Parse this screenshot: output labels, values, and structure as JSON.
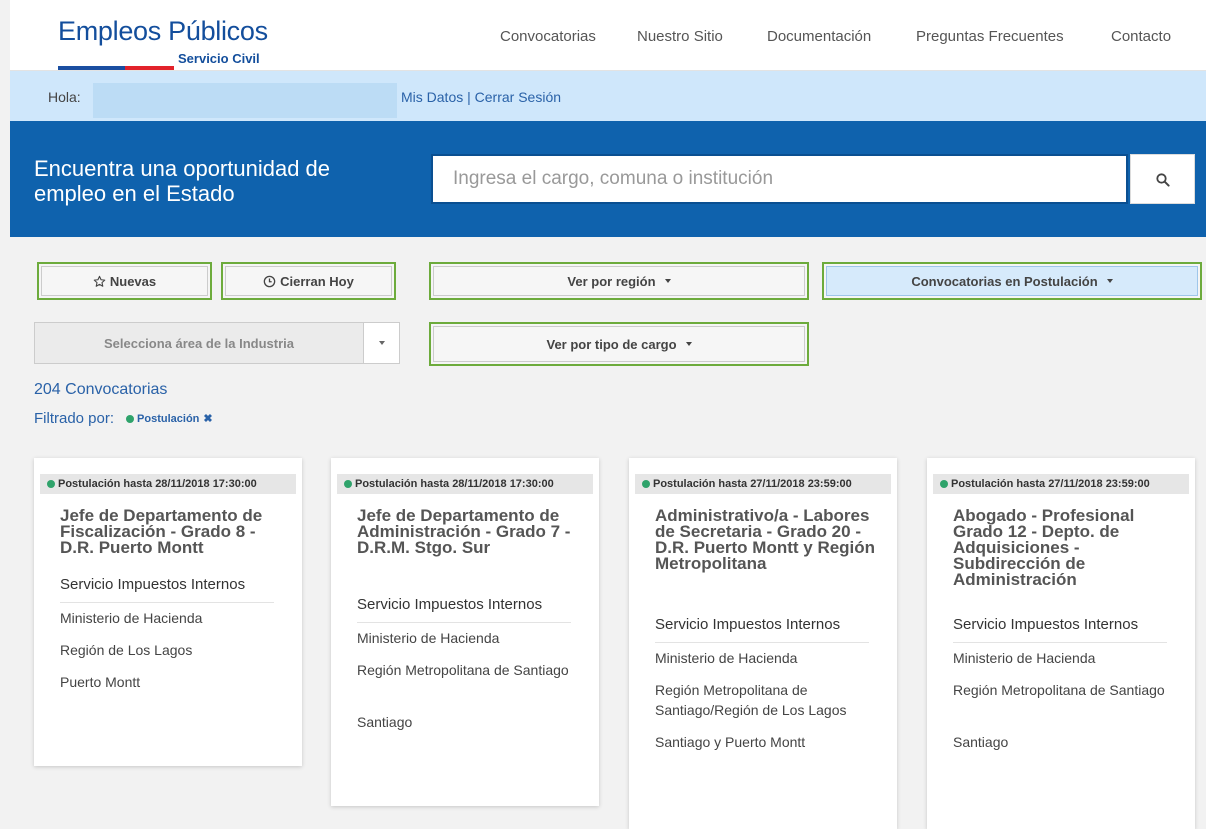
{
  "header": {
    "logo_title": "Empleos Públicos",
    "logo_subtitle": "Servicio Civil",
    "nav": [
      "Convocatorias",
      "Nuestro Sitio",
      "Documentación",
      "Preguntas Frecuentes",
      "Contacto"
    ]
  },
  "userbar": {
    "greeting": "Hola:",
    "my_data": "Mis Datos",
    "separator": "|",
    "logout": "Cerrar Sesión"
  },
  "hero": {
    "text": "Encuentra una oportunidad de empleo en el Estado",
    "search_placeholder": "Ingresa el cargo, comuna o institución",
    "search_icon": "search-icon"
  },
  "filters": {
    "new": "Nuevas",
    "close_today": "Cierran Hoy",
    "by_region": "Ver por región",
    "in_application": "Convocatorias en Postulación",
    "industry_area": "Selecciona área de la Industria",
    "by_job_type": "Ver por tipo de cargo"
  },
  "results": {
    "count": "204 Convocatorias",
    "filtered_by": "Filtrado por:",
    "active_filter": "Postulación"
  },
  "colors": {
    "brand_blue": "#0f62ad",
    "highlight_green": "#6dab3c",
    "status_green": "#2fa36b"
  },
  "cards": [
    {
      "deadline": "Postulación hasta 28/11/2018 17:30:00",
      "title": "Jefe de Departamento de Fiscalización - Grado 8 - D.R. Puerto Montt",
      "institution": "Servicio Impuestos Internos",
      "ministry": "Ministerio de Hacienda",
      "region": "Región de Los Lagos",
      "city": "Puerto Montt"
    },
    {
      "deadline": "Postulación hasta 28/11/2018 17:30:00",
      "title": "Jefe de Departamento de Administración - Grado 7 - D.R.M. Stgo. Sur",
      "institution": "Servicio Impuestos Internos",
      "ministry": "Ministerio de Hacienda",
      "region": "Región Metropolitana de Santiago",
      "city": "Santiago"
    },
    {
      "deadline": "Postulación hasta 27/11/2018 23:59:00",
      "title": "Administrativo/a - Labores de Secretaria - Grado 20 - D.R. Puerto Montt y Región Metropolitana",
      "institution": "Servicio Impuestos Internos",
      "ministry": "Ministerio de Hacienda",
      "region": "Región Metropolitana de Santiago/Región de Los Lagos",
      "city": "Santiago y Puerto Montt"
    },
    {
      "deadline": "Postulación hasta 27/11/2018 23:59:00",
      "title": "Abogado - Profesional Grado 12 - Depto. de Adquisiciones - Subdirección de Administración",
      "institution": "Servicio Impuestos Internos",
      "ministry": "Ministerio de Hacienda",
      "region": "Región Metropolitana de Santiago",
      "city": "Santiago"
    }
  ]
}
